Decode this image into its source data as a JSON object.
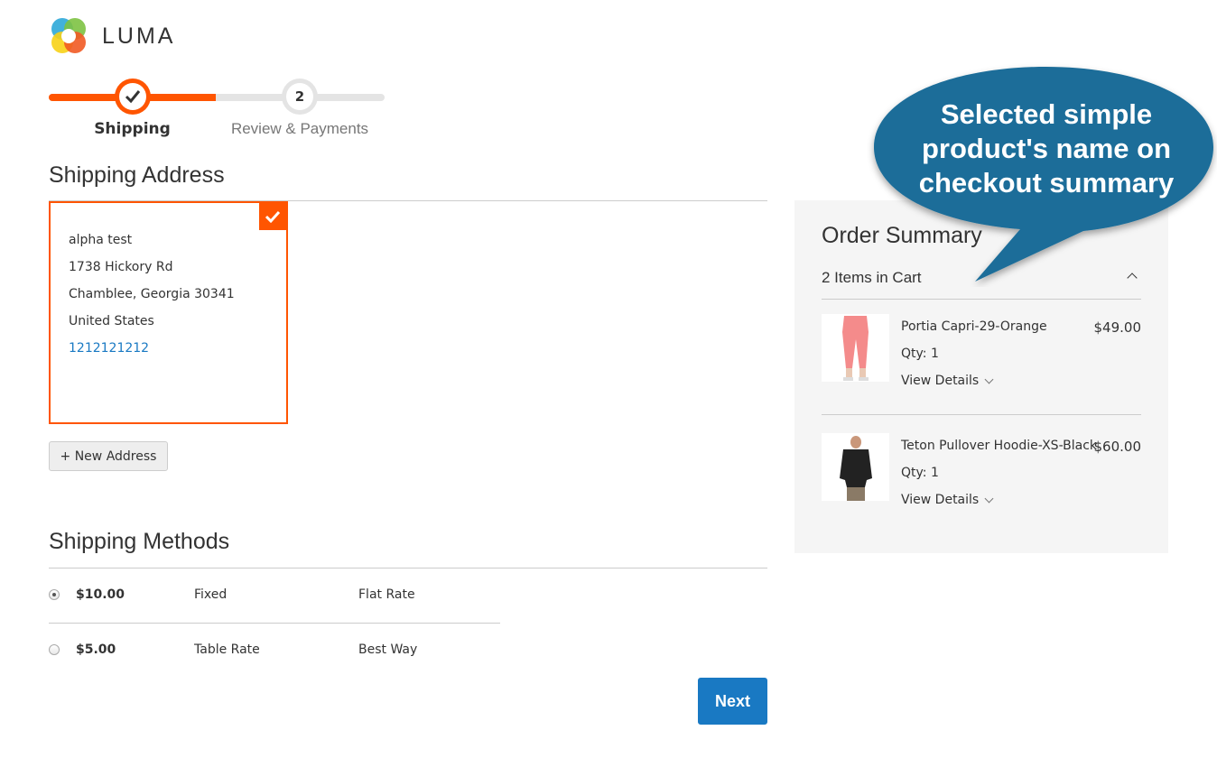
{
  "brand": {
    "name": "LUMA",
    "accent": "#ff5501",
    "link": "#1979c3"
  },
  "progress": {
    "steps": [
      {
        "label": "Shipping",
        "state": "complete"
      },
      {
        "number": "2",
        "label": "Review & Payments",
        "state": "pending"
      }
    ]
  },
  "shipping_address": {
    "title": "Shipping Address",
    "card": {
      "name": "alpha test",
      "street": "1738 Hickory Rd",
      "city_line": "Chamblee, Georgia 30341",
      "country": "United States",
      "phone": "1212121212",
      "selected": true
    },
    "new_address_label": "+ New Address"
  },
  "shipping_methods": {
    "title": "Shipping Methods",
    "rows": [
      {
        "price": "$10.00",
        "method": "Fixed",
        "carrier": "Flat Rate",
        "selected": true
      },
      {
        "price": "$5.00",
        "method": "Table Rate",
        "carrier": "Best Way",
        "selected": false
      }
    ]
  },
  "next_label": "Next",
  "order_summary": {
    "title": "Order Summary",
    "items_in_cart": "2 Items in Cart",
    "items": [
      {
        "name": "Portia Capri-29-Orange",
        "price": "$49.00",
        "qty": "Qty: 1",
        "details": "View Details",
        "image": "pink-capri-pants"
      },
      {
        "name": "Teton Pullover Hoodie-XS-Black",
        "price": "$60.00",
        "qty": "Qty: 1",
        "details": "View Details",
        "image": "black-hoodie"
      }
    ]
  },
  "callout": {
    "line1": "Selected simple",
    "line2": "product's name on",
    "line3": "checkout summary",
    "color": "#1a6d99"
  }
}
